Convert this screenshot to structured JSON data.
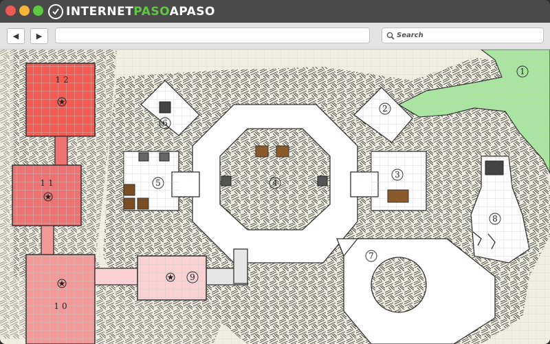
{
  "brand": {
    "name_prefix": "INTERNET",
    "name_accent": "PASO",
    "name_suffix": "APASO"
  },
  "toolbar": {
    "back_icon": "◀",
    "forward_icon": "▶",
    "address_value": "",
    "search_placeholder": "Search"
  },
  "colors": {
    "close": "#ee5b56",
    "minimize": "#f6b43b",
    "maximize": "#5fc843",
    "grass": "#a8e6a0",
    "room_dark_red": "#f25a52",
    "room_mid_red": "#ef7272",
    "room_light_red": "#f39a98",
    "room_pale_red": "#fbd1d1"
  },
  "map": {
    "rooms": [
      {
        "id": "room-1",
        "label": "1"
      },
      {
        "id": "room-2",
        "label": "2"
      },
      {
        "id": "room-3",
        "label": "3"
      },
      {
        "id": "room-4",
        "label": "4"
      },
      {
        "id": "room-5",
        "label": "5"
      },
      {
        "id": "room-6",
        "label": "6"
      },
      {
        "id": "room-7",
        "label": "7"
      },
      {
        "id": "room-8",
        "label": "8"
      },
      {
        "id": "room-9",
        "label": "9"
      },
      {
        "id": "room-10",
        "label": "10"
      },
      {
        "id": "room-11",
        "label": "11"
      },
      {
        "id": "room-12",
        "label": "12"
      }
    ]
  }
}
